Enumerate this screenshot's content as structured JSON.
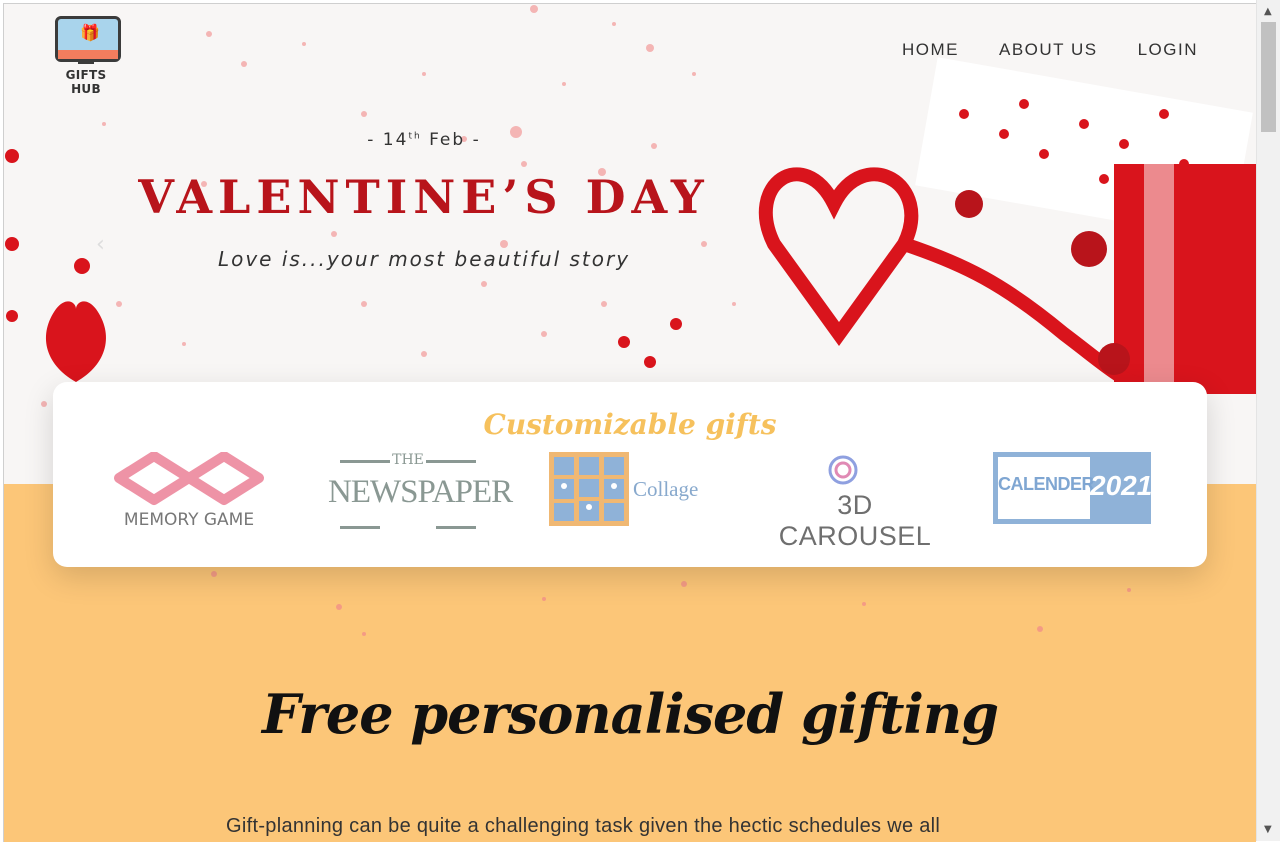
{
  "brand": {
    "name": "GIFTS HUB"
  },
  "nav": {
    "home": "HOME",
    "about": "ABOUT US",
    "login": "LOGIN"
  },
  "hero": {
    "date_day": "- 14",
    "date_sup": "th",
    "date_month": " Feb -",
    "title": "VALENTINE’S DAY",
    "tagline": "Love is...your most beautiful story"
  },
  "customizable": {
    "title": "Customizable gifts",
    "items": {
      "memory_game": "MEMORY GAME",
      "newspaper_the": "THE",
      "newspaper": "NEWSPAPER",
      "collage": "Collage",
      "carousel": "3D CAROUSEL",
      "calendar": "CALENDER",
      "calendar_year": "2021"
    }
  },
  "section": {
    "heading": "Free personalised gifting",
    "paragraph": "Gift-planning can be quite a challenging task given the hectic schedules we all"
  },
  "colors": {
    "accent": "#b8141b",
    "peach": "#fcc678",
    "gold": "#f6c15d"
  }
}
